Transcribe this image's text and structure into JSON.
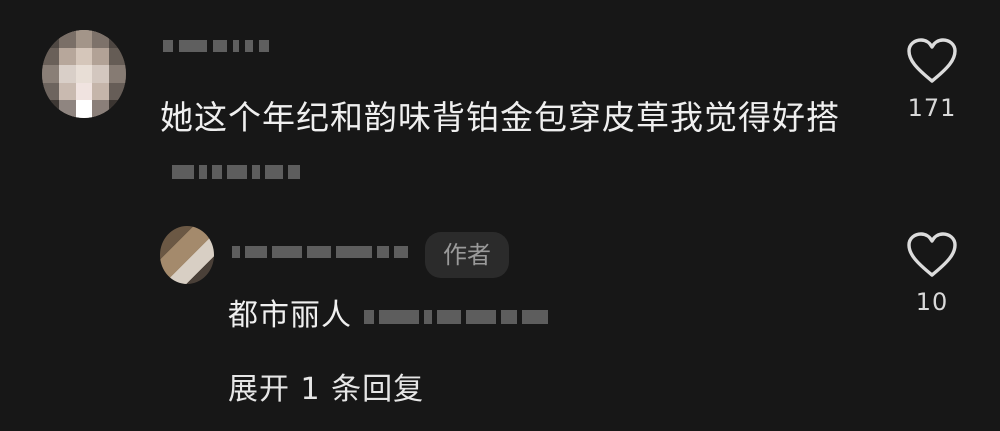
{
  "comment": {
    "text": "她这个年纪和韵味背铂金包穿皮草我觉得好搭",
    "like_count": "171",
    "avatar_icon": "avatar-icon",
    "like_icon": "heart-outline-icon"
  },
  "reply": {
    "author_badge": "作者",
    "text": "都市丽人",
    "like_count": "10",
    "like_icon": "heart-outline-icon"
  },
  "expand_replies": "展开 1 条回复",
  "colors": {
    "background": "#171717",
    "text": "#efefef",
    "muted": "#9a9a9a",
    "badge_bg": "#2b2b2b"
  }
}
